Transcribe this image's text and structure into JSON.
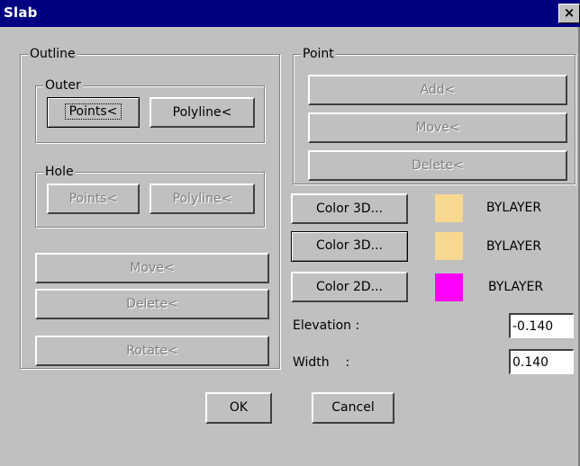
{
  "window": {
    "title": "Slab",
    "close_glyph": "×"
  },
  "outline": {
    "label": "Outline",
    "outer": {
      "label": "Outer",
      "points": "Points<",
      "polyline": "Polyline<"
    },
    "hole": {
      "label": "Hole",
      "points": "Points<",
      "polyline": "Polyline<"
    },
    "move": "Move<",
    "delete": "Delete<",
    "rotate": "Rotate<"
  },
  "point": {
    "label": "Point",
    "add": "Add<",
    "move": "Move<",
    "delete": "Delete<"
  },
  "colors": [
    {
      "button": "Color 3D...",
      "swatch_color": "#f8d890",
      "value": "BYLAYER"
    },
    {
      "button": "Color 3D...",
      "swatch_color": "#f8d890",
      "value": "BYLAYER"
    },
    {
      "button": "Color 2D...",
      "swatch_color": "#ff00ff",
      "value": "BYLAYER"
    }
  ],
  "elevation": {
    "label": "Elevation :",
    "value": "-0.140"
  },
  "width": {
    "label": "Width    :",
    "value": "0.140"
  },
  "ok": "OK",
  "cancel": "Cancel"
}
